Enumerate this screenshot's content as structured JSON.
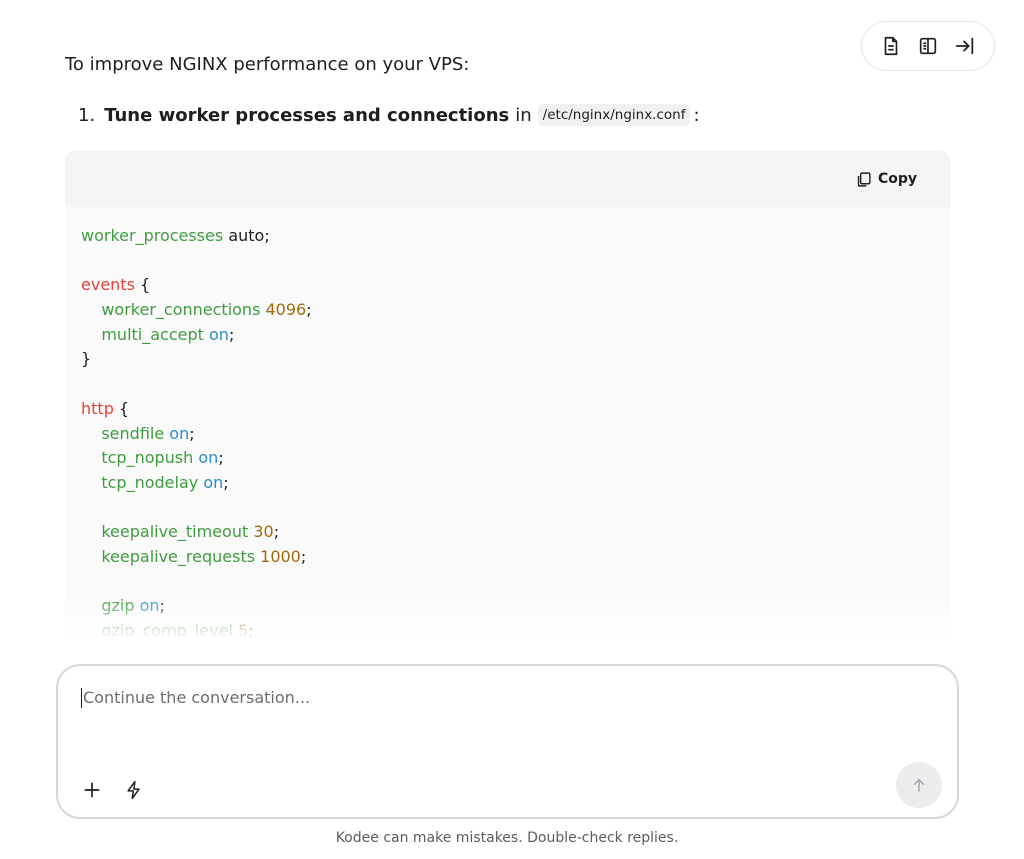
{
  "toolbar": {
    "buttons": [
      {
        "icon": "document-icon"
      },
      {
        "icon": "book-icon"
      },
      {
        "icon": "collapse-right-icon"
      }
    ]
  },
  "message": {
    "intro": "To improve NGINX performance on your VPS:",
    "step": {
      "number": "1.",
      "title": "Tune worker processes and connections",
      "connector": "in",
      "path": "/etc/nginx/nginx.conf",
      "suffix": ":"
    }
  },
  "codeblock": {
    "copy_label": "Copy",
    "lines": [
      [
        {
          "t": "worker_processes",
          "c": "d"
        },
        {
          "t": " auto;",
          "c": "p"
        }
      ],
      [],
      [
        {
          "t": "events",
          "c": "k"
        },
        {
          "t": " {",
          "c": "p"
        }
      ],
      [
        {
          "t": "    worker_connections",
          "c": "d"
        },
        {
          "t": " ",
          "c": "p"
        },
        {
          "t": "4096",
          "c": "n"
        },
        {
          "t": ";",
          "c": "p"
        }
      ],
      [
        {
          "t": "    multi_accept",
          "c": "d"
        },
        {
          "t": " ",
          "c": "p"
        },
        {
          "t": "on",
          "c": "b"
        },
        {
          "t": ";",
          "c": "p"
        }
      ],
      [
        {
          "t": "}",
          "c": "p"
        }
      ],
      [],
      [
        {
          "t": "http",
          "c": "k"
        },
        {
          "t": " {",
          "c": "p"
        }
      ],
      [
        {
          "t": "    sendfile",
          "c": "d"
        },
        {
          "t": " ",
          "c": "p"
        },
        {
          "t": "on",
          "c": "b"
        },
        {
          "t": ";",
          "c": "p"
        }
      ],
      [
        {
          "t": "    tcp_nopush",
          "c": "d"
        },
        {
          "t": " ",
          "c": "p"
        },
        {
          "t": "on",
          "c": "b"
        },
        {
          "t": ";",
          "c": "p"
        }
      ],
      [
        {
          "t": "    tcp_nodelay",
          "c": "d"
        },
        {
          "t": " ",
          "c": "p"
        },
        {
          "t": "on",
          "c": "b"
        },
        {
          "t": ";",
          "c": "p"
        }
      ],
      [],
      [
        {
          "t": "    keepalive_timeout",
          "c": "d"
        },
        {
          "t": " ",
          "c": "p"
        },
        {
          "t": "30",
          "c": "n"
        },
        {
          "t": ";",
          "c": "p"
        }
      ],
      [
        {
          "t": "    keepalive_requests",
          "c": "d"
        },
        {
          "t": " ",
          "c": "p"
        },
        {
          "t": "1000",
          "c": "n"
        },
        {
          "t": ";",
          "c": "p"
        }
      ],
      [],
      [
        {
          "t": "    gzip",
          "c": "d"
        },
        {
          "t": " ",
          "c": "p"
        },
        {
          "t": "on",
          "c": "b"
        },
        {
          "t": ";",
          "c": "p"
        }
      ],
      [
        {
          "t": "    gzip_comp_level",
          "c": "d"
        },
        {
          "t": " ",
          "c": "p"
        },
        {
          "t": "5",
          "c": "n"
        },
        {
          "t": ";",
          "c": "p"
        }
      ]
    ]
  },
  "composer": {
    "placeholder": "Continue the conversation...",
    "add_icon": "plus-icon",
    "tools_icon": "lightning-icon",
    "send_icon": "arrow-up-icon"
  },
  "footer": {
    "disclaimer": "Kodee can make mistakes. Double-check replies."
  },
  "colors": {
    "directive": "#3f9c3f",
    "block_keyword": "#e0443a",
    "number": "#a06a0c",
    "boolean": "#2a8ec4"
  }
}
